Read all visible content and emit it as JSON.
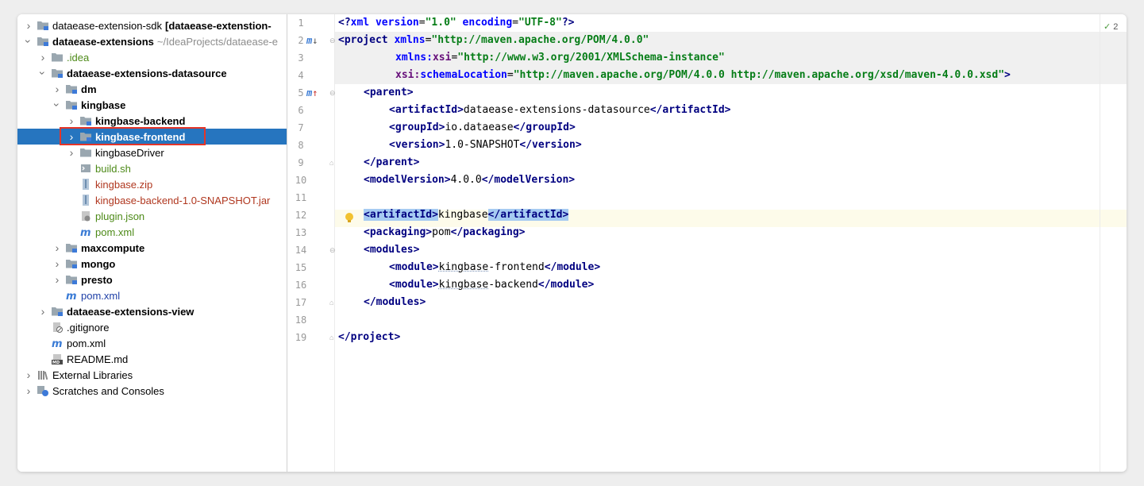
{
  "tree": {
    "items": [
      {
        "label": "dataease-extension-sdk",
        "suffix": "[dataease-extenstion-",
        "icon": "module-folder-icon",
        "arrow": "right",
        "indent": 0,
        "bold": false
      },
      {
        "label": "dataease-extensions",
        "suffix": "~/IdeaProjects/dataease-e",
        "icon": "module-folder-icon",
        "arrow": "down",
        "indent": 0,
        "bold": true
      },
      {
        "label": ".idea",
        "icon": "folder-icon",
        "arrow": "right",
        "indent": 1,
        "color": "green"
      },
      {
        "label": "dataease-extensions-datasource",
        "icon": "module-folder-icon",
        "arrow": "down",
        "indent": 1,
        "bold": true
      },
      {
        "label": "dm",
        "icon": "module-folder-icon",
        "arrow": "right",
        "indent": 2,
        "bold": true
      },
      {
        "label": "kingbase",
        "icon": "module-folder-icon",
        "arrow": "down",
        "indent": 2,
        "bold": true
      },
      {
        "label": "kingbase-backend",
        "icon": "module-folder-icon",
        "arrow": "right",
        "indent": 3,
        "bold": true
      },
      {
        "label": "kingbase-frontend",
        "icon": "module-folder-icon",
        "arrow": "right",
        "indent": 3,
        "bold": true,
        "selected": true
      },
      {
        "label": "kingbaseDriver",
        "icon": "folder-icon",
        "arrow": "right",
        "indent": 3
      },
      {
        "label": "build.sh",
        "icon": "shell-file-icon",
        "indent": 3,
        "color": "green"
      },
      {
        "label": "kingbase.zip",
        "icon": "archive-icon",
        "indent": 3,
        "color": "red"
      },
      {
        "label": "kingbase-backend-1.0-SNAPSHOT.jar",
        "icon": "archive-icon",
        "indent": 3,
        "color": "red"
      },
      {
        "label": "plugin.json",
        "icon": "json-file-icon",
        "indent": 3,
        "color": "green"
      },
      {
        "label": "pom.xml",
        "icon": "maven-file-icon",
        "indent": 3,
        "color": "green"
      },
      {
        "label": "maxcompute",
        "icon": "module-folder-icon",
        "arrow": "right",
        "indent": 2,
        "bold": true
      },
      {
        "label": "mongo",
        "icon": "module-folder-icon",
        "arrow": "right",
        "indent": 2,
        "bold": true
      },
      {
        "label": "presto",
        "icon": "module-folder-icon",
        "arrow": "right",
        "indent": 2,
        "bold": true
      },
      {
        "label": "pom.xml",
        "icon": "maven-file-icon",
        "indent": 2,
        "color": "blue"
      },
      {
        "label": "dataease-extensions-view",
        "icon": "module-folder-icon",
        "arrow": "right",
        "indent": 1,
        "bold": true
      },
      {
        "label": ".gitignore",
        "icon": "ignore-file-icon",
        "indent": 1
      },
      {
        "label": "pom.xml",
        "icon": "maven-file-icon",
        "indent": 1
      },
      {
        "label": "README.md",
        "icon": "markdown-file-icon",
        "indent": 1
      },
      {
        "label": "External Libraries",
        "icon": "libraries-icon",
        "arrow": "right",
        "indent": 0
      },
      {
        "label": "Scratches and Consoles",
        "icon": "scratches-icon",
        "arrow": "right",
        "indent": 0
      }
    ]
  },
  "editor": {
    "inspection_count": "2",
    "line_numbers": [
      "1",
      "2",
      "3",
      "4",
      "5",
      "6",
      "7",
      "8",
      "9",
      "10",
      "11",
      "12",
      "13",
      "14",
      "15",
      "16",
      "17",
      "18",
      "19"
    ],
    "lines": {
      "l1": {
        "a": "<?",
        "b": "xml",
        "c": " version",
        "d": "=",
        "e": "\"1.0\"",
        "f": " encoding",
        "g": "=",
        "h": "\"UTF-8\"",
        "i": "?>"
      },
      "l2": {
        "a": "<project",
        "b": " xmlns",
        "c": "=",
        "d": "\"http://maven.apache.org/POM/4.0.0\""
      },
      "l3": {
        "a": "xmlns:",
        "b": "xsi",
        "c": "=",
        "d": "\"http://www.w3.org/2001/XMLSchema-instance\""
      },
      "l4": {
        "a": "xsi:",
        "b": "schemaLocation",
        "c": "=",
        "d": "\"http://maven.apache.org/POM/4.0.0 http://maven.apache.org/xsd/maven-4.0.0.xsd\"",
        "e": ">"
      },
      "l5": {
        "a": "<parent>"
      },
      "l6": {
        "a": "<artifactId>",
        "b": "dataease-extensions-datasource",
        "c": "</artifactId>"
      },
      "l7": {
        "a": "<groupId>",
        "b": "io.dataease",
        "c": "</groupId>"
      },
      "l8": {
        "a": "<version>",
        "b": "1.0-SNAPSHOT",
        "c": "</version>"
      },
      "l9": {
        "a": "</parent>"
      },
      "l10": {
        "a": "<modelVersion>",
        "b": "4.0.0",
        "c": "</modelVersion>"
      },
      "l12": {
        "a": "<artifactId>",
        "b": "kingbase",
        "c": "</artifactId>"
      },
      "l13": {
        "a": "<packaging>",
        "b": "pom",
        "c": "</packaging>"
      },
      "l14": {
        "a": "<modules>"
      },
      "l15": {
        "a": "<module>",
        "b1": "kingbase",
        "b2": "-frontend",
        "c": "</module>"
      },
      "l16": {
        "a": "<module>",
        "b1": "kingbase",
        "b2": "-backend",
        "c": "</module>"
      },
      "l17": {
        "a": "</modules>"
      },
      "l19": {
        "a": "</project>"
      }
    }
  }
}
